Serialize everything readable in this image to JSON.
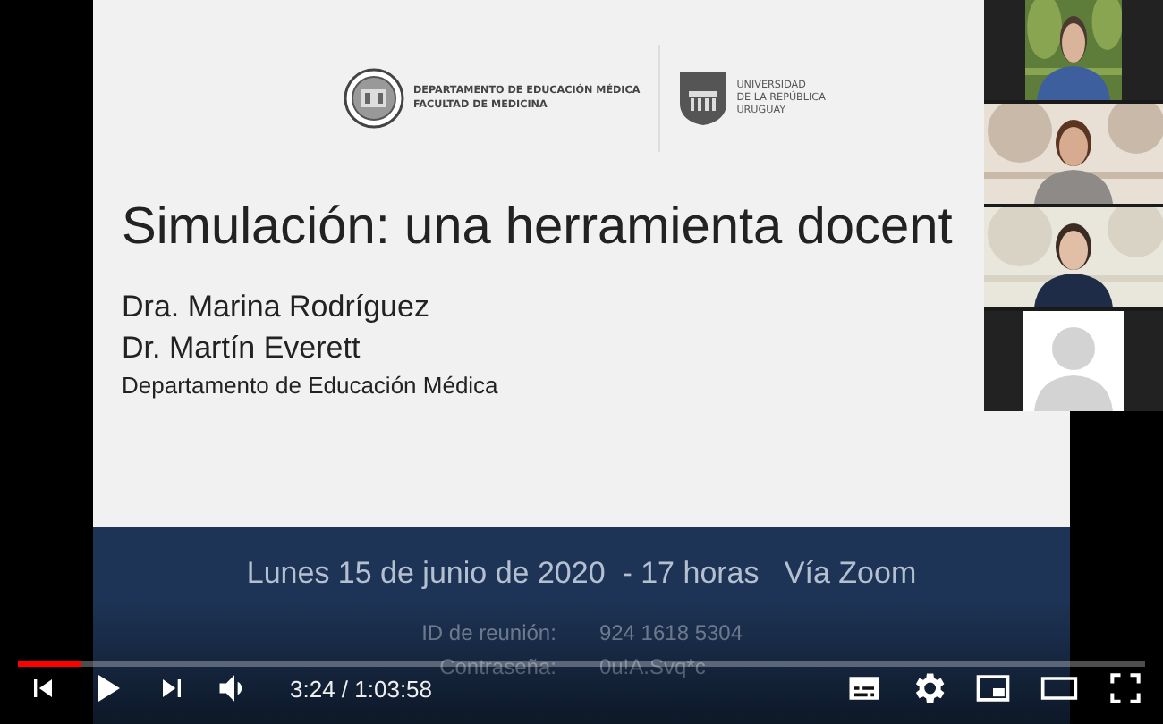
{
  "slide": {
    "header_left": [
      "DEPARTAMENTO DE EDUCACIÓN MÉDICA",
      "FACULTAD DE MEDICINA"
    ],
    "header_right": [
      "UNIVERSIDAD",
      "DE LA REPÚBLICA",
      "URUGUAY"
    ],
    "title": "Simulación: una herramienta docent",
    "authors": [
      "Dra. Marina Rodríguez",
      "Dr. Martín Everett"
    ],
    "department": "Departamento de Educación Médica",
    "event_line": "Lunes 15 de junio de 2020  - 17 horas   Vía Zoom",
    "details": [
      {
        "label": "ID de reunión:",
        "value": "924 1618 5304"
      },
      {
        "label": "Contraseña:",
        "value": "0u!A.Svq*c"
      }
    ]
  },
  "participants": [
    {
      "kind": "picture"
    },
    {
      "kind": "picture"
    },
    {
      "kind": "picture"
    },
    {
      "kind": "placeholder"
    }
  ],
  "player": {
    "progress": {
      "level": 0.056
    },
    "playing": false,
    "time": "3:24 / 1:03:58"
  }
}
